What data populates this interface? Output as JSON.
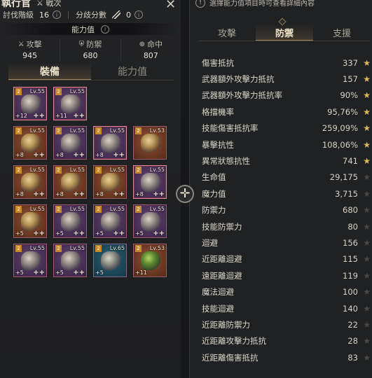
{
  "header": {
    "title": "執行官",
    "subtitle": "戦次",
    "rank_label": "討伐階級",
    "rank_value": "16",
    "pvp_label": "分歧分數",
    "pvp_value": "0",
    "ability_bar": "能力值"
  },
  "summary_stats": [
    {
      "icon": "crossed-swords-icon",
      "label": "攻擊",
      "value": "945"
    },
    {
      "icon": "shield-icon",
      "label": "防禦",
      "value": "680"
    },
    {
      "icon": "crosshair-icon",
      "label": "命中",
      "value": "807"
    }
  ],
  "left_tabs": [
    {
      "label": "裝備",
      "active": true
    },
    {
      "label": "能力值",
      "active": false
    }
  ],
  "equipment": [
    {
      "lv": "Lv.55",
      "plus": "+12",
      "pp": "++",
      "style": "purple",
      "sel": true
    },
    {
      "lv": "Lv.55",
      "plus": "+11",
      "pp": "++",
      "style": "purple",
      "sel": true
    },
    {
      "lv": "Lv.55",
      "plus": "+8",
      "pp": "++",
      "style": "orange",
      "sel": false
    },
    {
      "lv": "Lv.55",
      "plus": "+8",
      "pp": "++",
      "style": "purple",
      "sel": false
    },
    {
      "lv": "Lv.55",
      "plus": "+8",
      "pp": "++",
      "style": "purple",
      "sel": true
    },
    {
      "lv": "Lv.53",
      "plus": "",
      "pp": "",
      "style": "orange",
      "sel": false
    },
    {
      "lv": "Lv.55",
      "plus": "+8",
      "pp": "++",
      "style": "orange",
      "sel": false
    },
    {
      "lv": "Lv.55",
      "plus": "+8",
      "pp": "++",
      "style": "orange",
      "sel": false
    },
    {
      "lv": "Lv.55",
      "plus": "+8",
      "pp": "++",
      "style": "orange",
      "sel": false
    },
    {
      "lv": "Lv.55",
      "plus": "+8",
      "pp": "++",
      "style": "purple",
      "sel": true
    },
    {
      "lv": "Lv.55",
      "plus": "+5",
      "pp": "++",
      "style": "orange",
      "sel": false
    },
    {
      "lv": "Lv.55",
      "plus": "+5",
      "pp": "++",
      "style": "purple",
      "sel": false
    },
    {
      "lv": "Lv.55",
      "plus": "+5",
      "pp": "++",
      "style": "purple",
      "sel": false
    },
    {
      "lv": "Lv.55",
      "plus": "+5",
      "pp": "++",
      "style": "purple",
      "sel": false
    },
    {
      "lv": "Lv.55",
      "plus": "+5",
      "pp": "++",
      "style": "purple",
      "sel": false
    },
    {
      "lv": "Lv.55",
      "plus": "+5",
      "pp": "++",
      "style": "purple",
      "sel": false
    },
    {
      "lv": "Lv.65",
      "plus": "+5",
      "pp": "",
      "style": "blue",
      "sel": false
    },
    {
      "lv": "Lv.53",
      "plus": "+11",
      "pp": "",
      "style": "green",
      "sel": false
    }
  ],
  "notice": "選擇能力值項目時可查看詳細內容",
  "right_tabs": [
    {
      "label": "攻擊",
      "active": false
    },
    {
      "label": "防禦",
      "active": true
    },
    {
      "label": "支援",
      "active": false
    }
  ],
  "defense_stats": [
    {
      "name": "傷害抵抗",
      "value": "337",
      "star": true
    },
    {
      "name": "武器額外攻擊力抵抗",
      "value": "157",
      "star": true
    },
    {
      "name": "武器額外攻擊力抵抗率",
      "value": "90%",
      "star": true
    },
    {
      "name": "格擋機率",
      "value": "95,76%",
      "star": true
    },
    {
      "name": "技能傷害抵抗率",
      "value": "259,09%",
      "star": true
    },
    {
      "name": "暴擊抗性",
      "value": "108,06%",
      "star": true
    },
    {
      "name": "異常狀態抗性",
      "value": "741",
      "star": true
    },
    {
      "name": "生命值",
      "value": "29,175",
      "star": false
    },
    {
      "name": "魔力值",
      "value": "3,715",
      "star": false
    },
    {
      "name": "防禦力",
      "value": "680",
      "star": false
    },
    {
      "name": "技能防禦力",
      "value": "80",
      "star": false
    },
    {
      "name": "迴避",
      "value": "156",
      "star": false
    },
    {
      "name": "近距離迴避",
      "value": "115",
      "star": false
    },
    {
      "name": "遠距離迴避",
      "value": "119",
      "star": false
    },
    {
      "name": "魔法迴避",
      "value": "100",
      "star": false
    },
    {
      "name": "技能迴避",
      "value": "140",
      "star": false
    },
    {
      "name": "近距離防禦力",
      "value": "22",
      "star": false
    },
    {
      "name": "近距離攻擊力抵抗",
      "value": "28",
      "star": false
    },
    {
      "name": "近距離傷害抵抗",
      "value": "83",
      "star": false
    }
  ],
  "colors": {
    "accent": "#a58c5c",
    "star_on": "#e0b85a",
    "star_off": "#4a4946"
  }
}
